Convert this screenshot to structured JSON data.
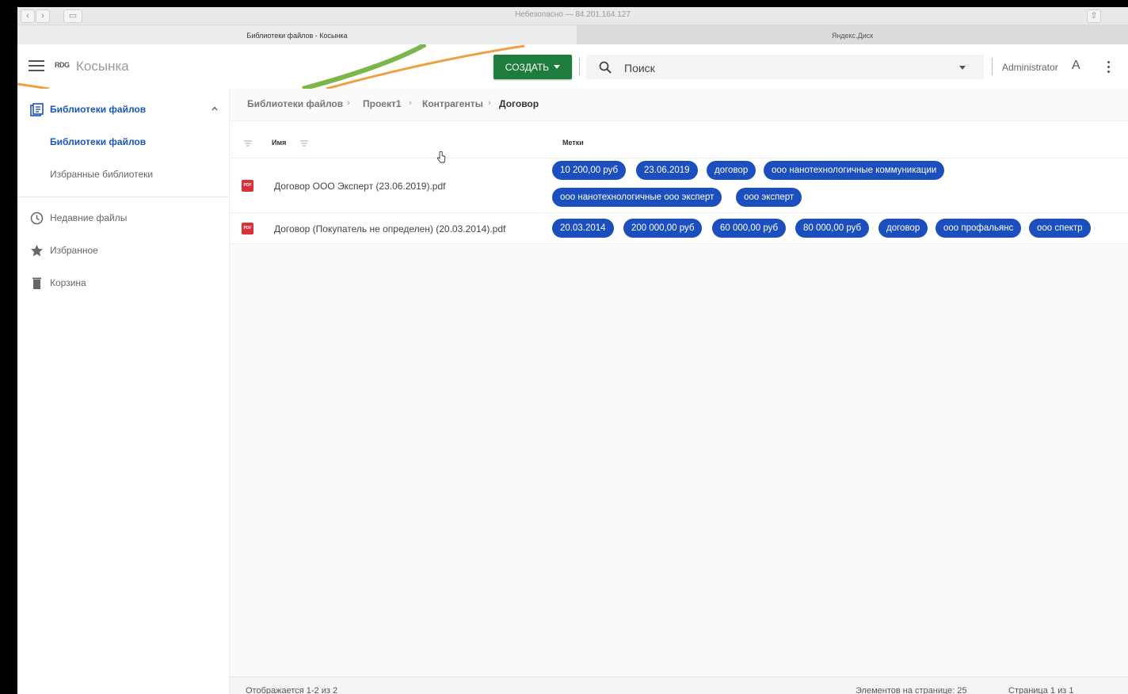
{
  "browser": {
    "address": "Небезопасно — 84.201.164.127",
    "tabs": [
      {
        "label": "Библиотеки файлов - Косынка",
        "active": true
      },
      {
        "label": "Яндекс.Диск",
        "active": false
      }
    ]
  },
  "header": {
    "logo_badge": "RDG",
    "logo_text": "Косынка",
    "create_label": "СОЗДАТЬ",
    "search_placeholder": "Поиск",
    "user_name": "Administrator",
    "user_initial": "A"
  },
  "sidebar": {
    "section": {
      "label": "Библиотеки файлов"
    },
    "sub_items": [
      {
        "label": "Библиотеки файлов",
        "active": true
      },
      {
        "label": "Избранные библиотеки",
        "active": false
      }
    ],
    "items": [
      {
        "label": "Недавние файлы",
        "icon": "clock-icon"
      },
      {
        "label": "Избранное",
        "icon": "star-icon"
      },
      {
        "label": "Корзина",
        "icon": "trash-icon"
      }
    ]
  },
  "breadcrumb": [
    "Библиотеки файлов",
    "Проект1",
    "Контрагенты",
    "Договор"
  ],
  "table": {
    "col_name": "Имя",
    "col_tags": "Метки",
    "rows": [
      {
        "name": "Договор ООО Эксперт (23.06.2019).pdf",
        "icon_label": "PDF",
        "tags": [
          "10 200,00 руб",
          "23.06.2019",
          "договор",
          "ооо нанотехнологичные коммуникации",
          "ооо нанотехнологичные ооо эксперт",
          "ооо эксперт"
        ]
      },
      {
        "name": "Договор (Покупатель не определен) (20.03.2014).pdf",
        "icon_label": "PDF",
        "tags": [
          "20.03.2014",
          "200 000,00 руб",
          "60 000,00 руб",
          "80 000,00 руб",
          "договор",
          "ооо профальянс",
          "ооо спектр"
        ]
      }
    ]
  },
  "footer": {
    "shown": "Отображается 1-2 из 2",
    "per_page": "Элементов на странице: 25",
    "page": "Страница 1 из 1"
  },
  "colors": {
    "tag_bg": "#1a4fbd",
    "create_bg": "#1e7c3c",
    "active_blue": "#1a55b8",
    "pdf_red": "#d9303a"
  }
}
